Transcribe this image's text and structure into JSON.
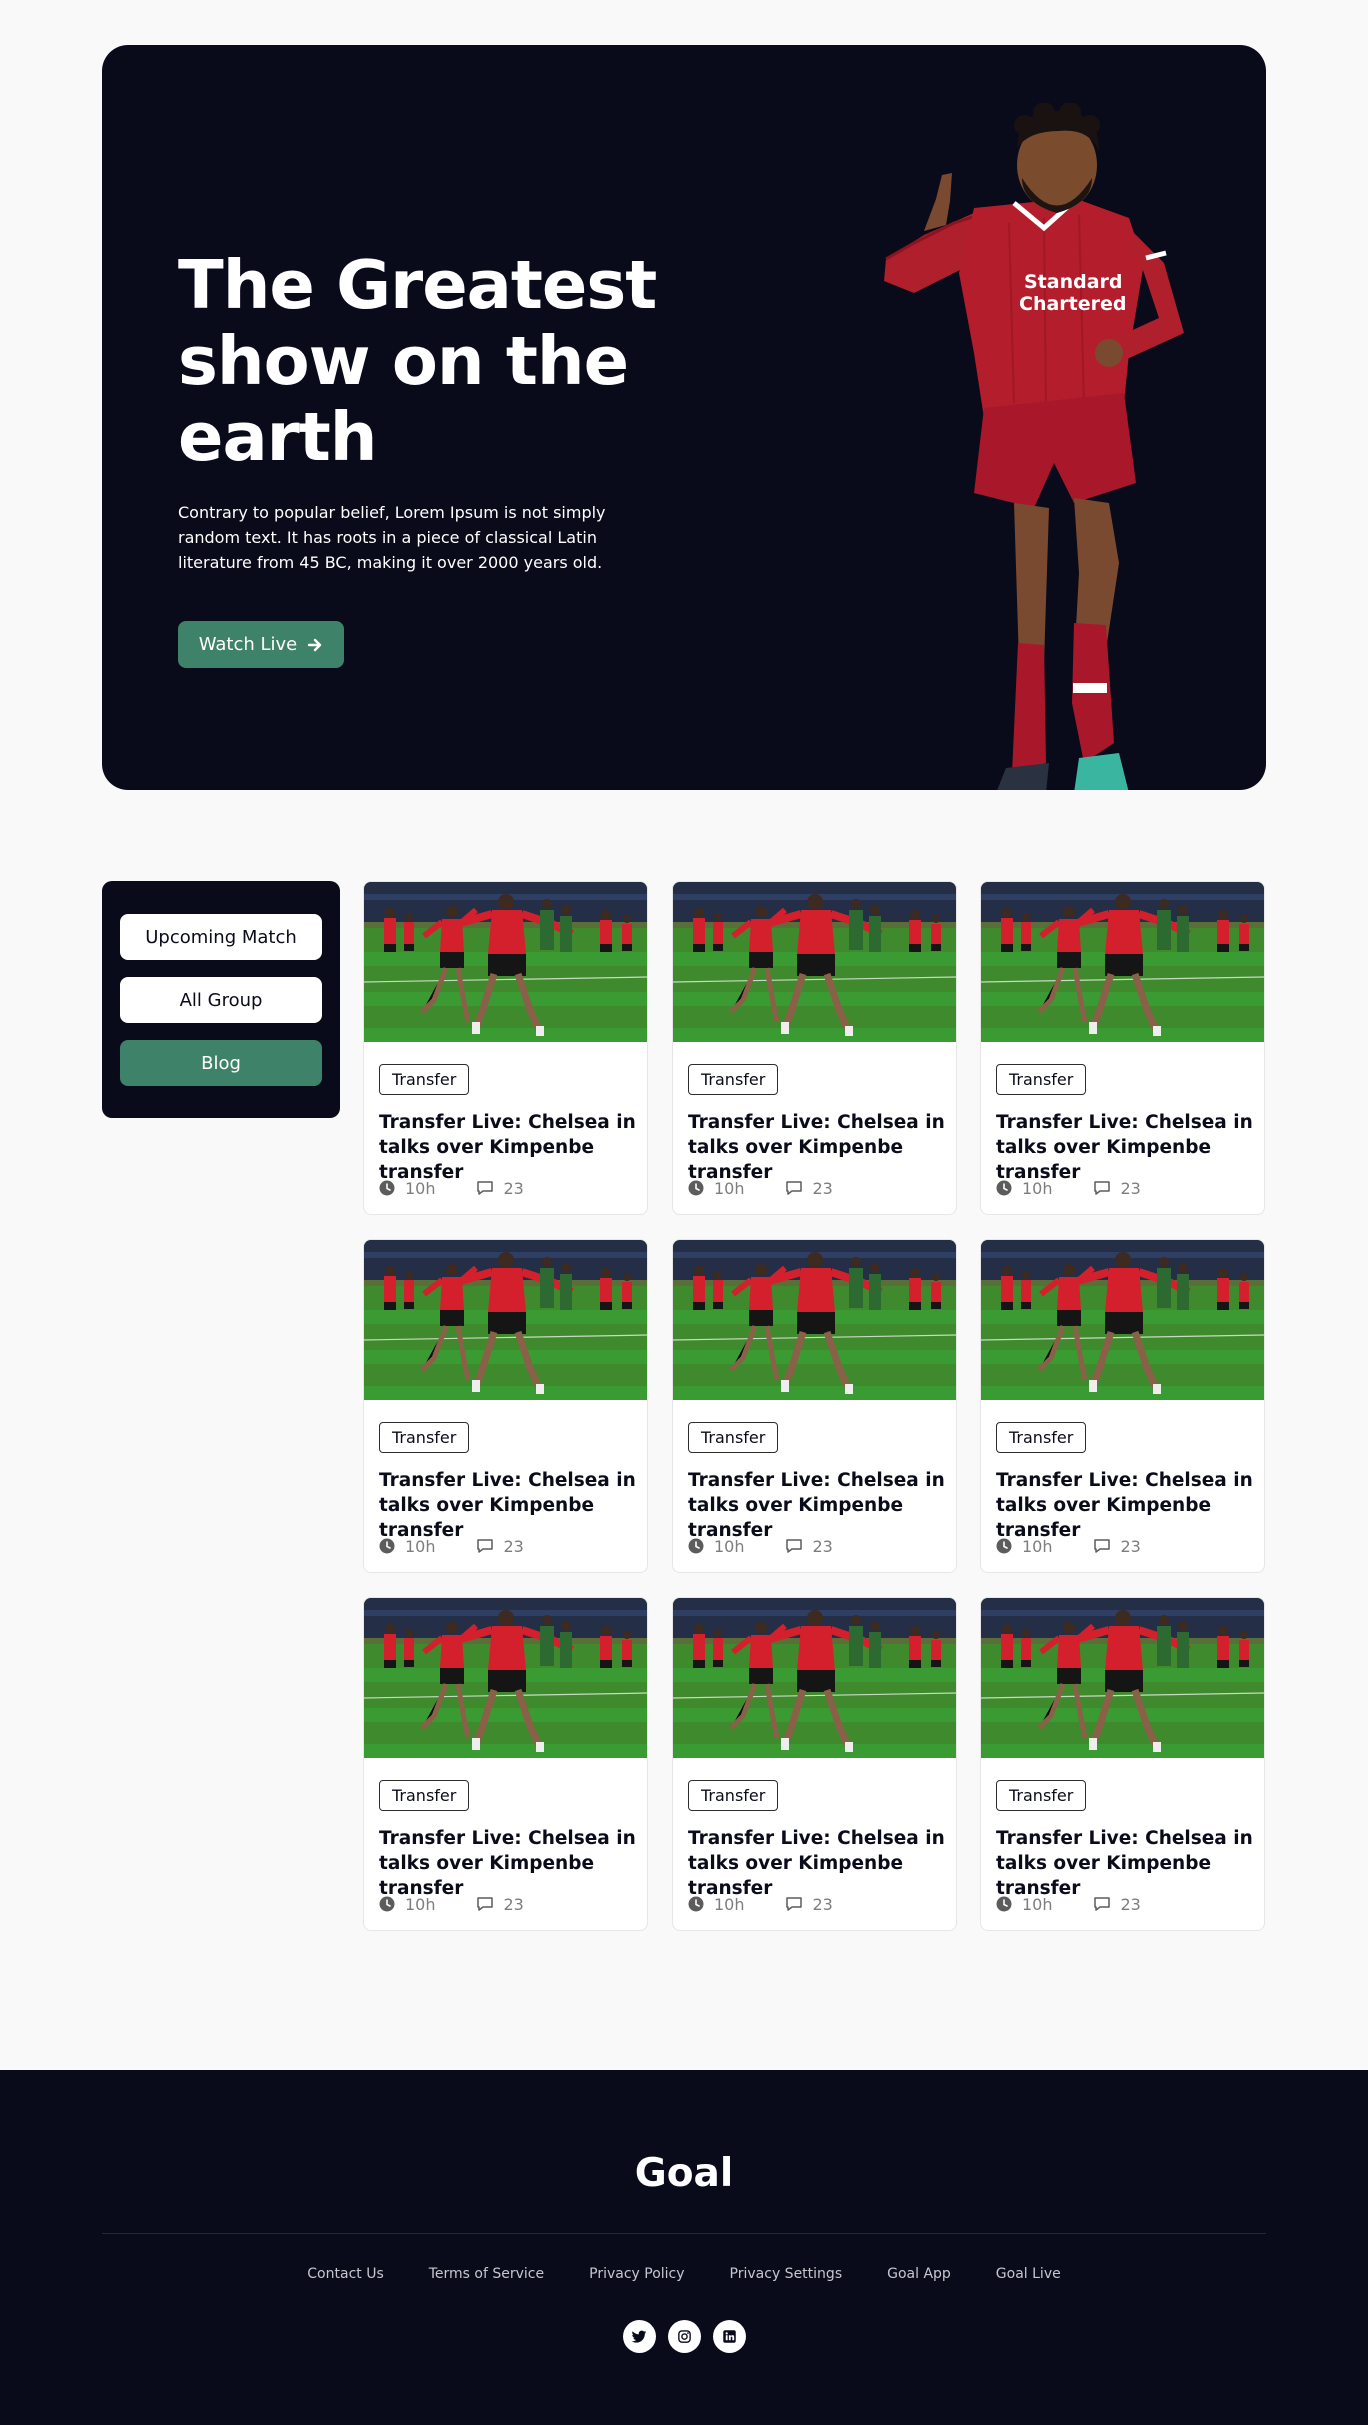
{
  "hero": {
    "title": "The Greatest show on the earth",
    "description": "Contrary to popular belief, Lorem Ipsum is not simply random text. It has roots in a piece of classical Latin literature from 45 BC, making it over 2000 years old.",
    "cta_label": "Watch Live",
    "cta_icon": "arrow-right-icon"
  },
  "sidebar": {
    "items": [
      {
        "label": "Upcoming Match",
        "active": false
      },
      {
        "label": "All Group",
        "active": false
      },
      {
        "label": "Blog",
        "active": true
      }
    ]
  },
  "cards": [
    {
      "tag": "Transfer",
      "title": "Transfer Live: Chelsea in talks over Kimpenbe transfer",
      "time": "10h",
      "comments": "23"
    },
    {
      "tag": "Transfer",
      "title": "Transfer Live: Chelsea in talks over Kimpenbe transfer",
      "time": "10h",
      "comments": "23"
    },
    {
      "tag": "Transfer",
      "title": "Transfer Live: Chelsea in talks over Kimpenbe transfer",
      "time": "10h",
      "comments": "23"
    },
    {
      "tag": "Transfer",
      "title": "Transfer Live: Chelsea in talks over Kimpenbe transfer",
      "time": "10h",
      "comments": "23"
    },
    {
      "tag": "Transfer",
      "title": "Transfer Live: Chelsea in talks over Kimpenbe transfer",
      "time": "10h",
      "comments": "23"
    },
    {
      "tag": "Transfer",
      "title": "Transfer Live: Chelsea in talks over Kimpenbe transfer",
      "time": "10h",
      "comments": "23"
    },
    {
      "tag": "Transfer",
      "title": "Transfer Live: Chelsea in talks over Kimpenbe transfer",
      "time": "10h",
      "comments": "23"
    },
    {
      "tag": "Transfer",
      "title": "Transfer Live: Chelsea in talks over Kimpenbe transfer",
      "time": "10h",
      "comments": "23"
    },
    {
      "tag": "Transfer",
      "title": "Transfer Live: Chelsea in talks over Kimpenbe transfer",
      "time": "10h",
      "comments": "23"
    }
  ],
  "footer": {
    "logo": "Goal",
    "links": [
      "Contact Us",
      "Terms of Service",
      "Privacy Policy",
      "Privacy Settings",
      "Goal App",
      "Goal Live"
    ],
    "socials": [
      "twitter-icon",
      "instagram-icon",
      "linkedin-icon"
    ]
  },
  "colors": {
    "dark": "#0a0b1a",
    "accent": "#3f826a",
    "page_bg": "#f9f9f9"
  }
}
